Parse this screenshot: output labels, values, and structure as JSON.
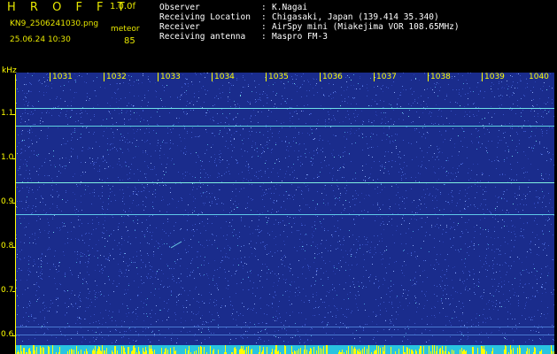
{
  "header": {
    "logo": "H R O F F T",
    "version": "1.0.0f",
    "filename": "KN9_2506241030.png",
    "datetime": "25.06.24 10:30",
    "meteor_label": "meteor",
    "meteor_count": "85"
  },
  "info": [
    {
      "key": "Observer",
      "value": "K.Nagai"
    },
    {
      "key": "Receiving Location",
      "value": "Chigasaki, Japan (139.414 35.340)"
    },
    {
      "key": "Receiver",
      "value": "AirSpy mini (Miakejima VOR 108.65MHz)"
    },
    {
      "key": "Receiving antenna",
      "value": "Maspro FM-3"
    }
  ],
  "y_axis": {
    "unit": "kHz",
    "ticks": [
      "1.1",
      "1.0",
      "0.9",
      "0.8",
      "0.7",
      "0.6"
    ]
  },
  "x_axis": {
    "ticks": [
      "1031",
      "1032",
      "1033",
      "1034",
      "1035",
      "1036",
      "1037",
      "1038",
      "1039",
      "1040"
    ]
  },
  "colors": {
    "background": "#000000",
    "accent": "#ffff00",
    "spectrum": "#1a2c8c",
    "signal": "#5fd8e8"
  }
}
